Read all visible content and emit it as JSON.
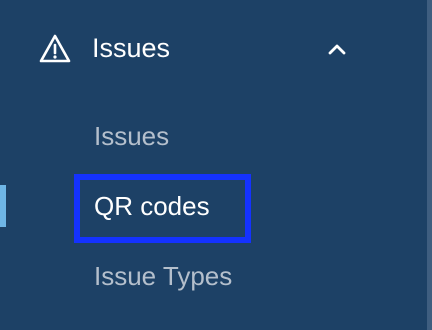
{
  "sidebar": {
    "group": {
      "label": "Issues",
      "icon": "warning-icon",
      "expand_icon": "chevron-up-icon",
      "expanded": true
    },
    "items": [
      {
        "label": "Issues",
        "active": false
      },
      {
        "label": "QR codes",
        "active": true
      },
      {
        "label": "Issue Types",
        "active": false
      }
    ]
  },
  "colors": {
    "background": "#1d4166",
    "text_active": "#ffffff",
    "text_inactive": "#b4bfcc",
    "highlight_border": "#1432ff",
    "active_indicator": "#6fb6e6"
  }
}
